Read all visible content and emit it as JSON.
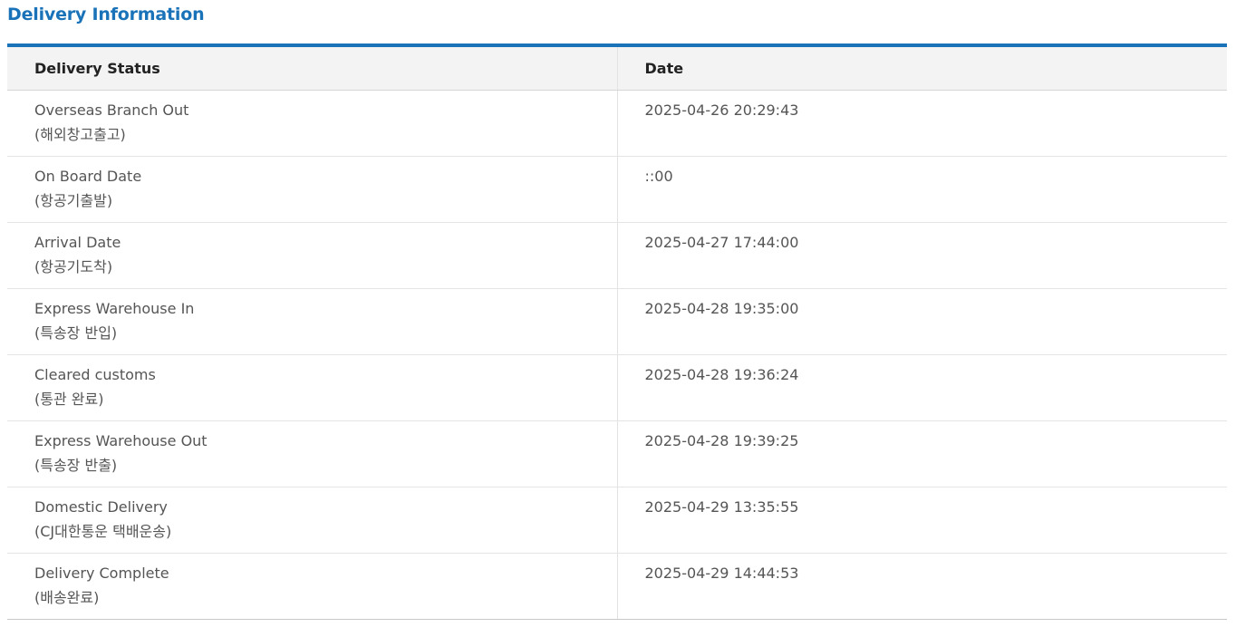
{
  "section": {
    "title": "Delivery Information"
  },
  "table": {
    "headers": {
      "status": "Delivery Status",
      "date": "Date"
    },
    "rows": [
      {
        "status_en": "Overseas Branch Out",
        "status_ko": "(해외창고출고)",
        "date": "2025-04-26 20:29:43"
      },
      {
        "status_en": "On Board Date",
        "status_ko": "(항공기출발)",
        "date": "::00"
      },
      {
        "status_en": "Arrival Date",
        "status_ko": "(항공기도착)",
        "date": "2025-04-27 17:44:00"
      },
      {
        "status_en": "Express Warehouse In",
        "status_ko": "(특송장 반입)",
        "date": "2025-04-28 19:35:00"
      },
      {
        "status_en": "Cleared customs",
        "status_ko": "(통관 완료)",
        "date": "2025-04-28 19:36:24"
      },
      {
        "status_en": "Express Warehouse Out",
        "status_ko": "(특송장 반출)",
        "date": "2025-04-28 19:39:25"
      },
      {
        "status_en": "Domestic Delivery",
        "status_ko": "(CJ대한통운 택배운송)",
        "date": "2025-04-29 13:35:55"
      },
      {
        "status_en": "Delivery Complete",
        "status_ko": "(배송완료)",
        "date": "2025-04-29 14:44:53"
      }
    ]
  },
  "colors": {
    "accent": "#1a73b8",
    "header_bg": "#f3f3f3",
    "text": "#555555"
  }
}
